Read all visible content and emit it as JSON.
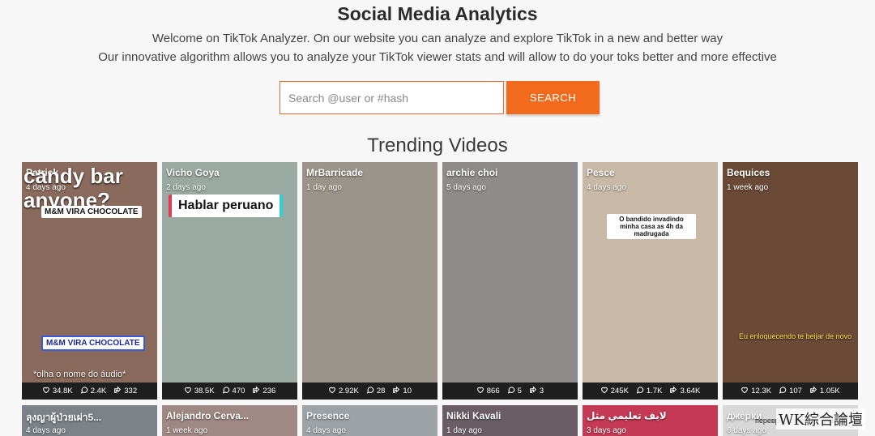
{
  "header": {
    "title": "Social Media Analytics",
    "line1": "Welcome on TikTok Analyzer. On our website you can analyze and explore TikTok in a new and better way",
    "line2": "Our innovative algorithm allows you to analyze your TikTok viewer stats and will allow to do your toks better and more effective"
  },
  "search": {
    "placeholder": "Search @user or #hash",
    "button": "SEARCH"
  },
  "trending_title": "Trending Videos",
  "videos": [
    {
      "user": "Patrick",
      "ago": "4 days ago",
      "likes": "34.8K",
      "comments": "2.4K",
      "shares": "332",
      "overlay1": "M&M VIRA CHOCOLATE",
      "overlay2": "M&M VIRA CHOCOLATE",
      "caption": "*olha o nome do áudio*",
      "bigtext": "candy bar anyone?",
      "bg": "#8a6a5c"
    },
    {
      "user": "Vicho Goya",
      "ago": "2 days ago",
      "likes": "38.5K",
      "comments": "470",
      "shares": "236",
      "overlay1": "Hablar peruano",
      "bg": "#9aa9a2"
    },
    {
      "user": "MrBarricade",
      "ago": "1 day ago",
      "likes": "2.92K",
      "comments": "28",
      "shares": "10",
      "bg": "#9b948a"
    },
    {
      "user": "archie choi",
      "ago": "5 days ago",
      "likes": "866",
      "comments": "5",
      "shares": "3",
      "bg": "#8d8c8a"
    },
    {
      "user": "Pesce",
      "ago": "4 days ago",
      "likes": "245K",
      "comments": "1.7K",
      "shares": "3.64K",
      "overlay1": "O bandido invadindo minha casa as 4h da madrugada",
      "bg": "#c8b8a6"
    },
    {
      "user": "Bequices",
      "ago": "1 week ago",
      "likes": "12.3K",
      "comments": "107",
      "shares": "1.05K",
      "caption": "Eu enloquecendo te beijar de novo",
      "bg": "#6a4a36"
    }
  ],
  "videos_row2": [
    {
      "user": "ลุงญาผู้ป่วยเผ่า5...",
      "ago": "4 days ago",
      "bg": "#7b8288"
    },
    {
      "user": "Alejandro Cerva...",
      "ago": "1 week ago",
      "bg": "#a08884"
    },
    {
      "user": "Presence",
      "ago": "4 days ago",
      "bg": "#9da3a6"
    },
    {
      "user": "Nikki Kavali",
      "ago": "1 day ago",
      "bg": "#6b5d66"
    },
    {
      "user": "لايف تعليمي مثل",
      "ago": "3 days ago",
      "bg": "#c43a55"
    },
    {
      "user": "джерки",
      "ago": "6 days ago",
      "caption": "переврестся вверх днои.",
      "bg": "#d8d8d8"
    }
  ],
  "watermark": "WK綜合論壇",
  "colors": {
    "accent": "#f26a1b",
    "card_footer": "#1f1f1f"
  }
}
